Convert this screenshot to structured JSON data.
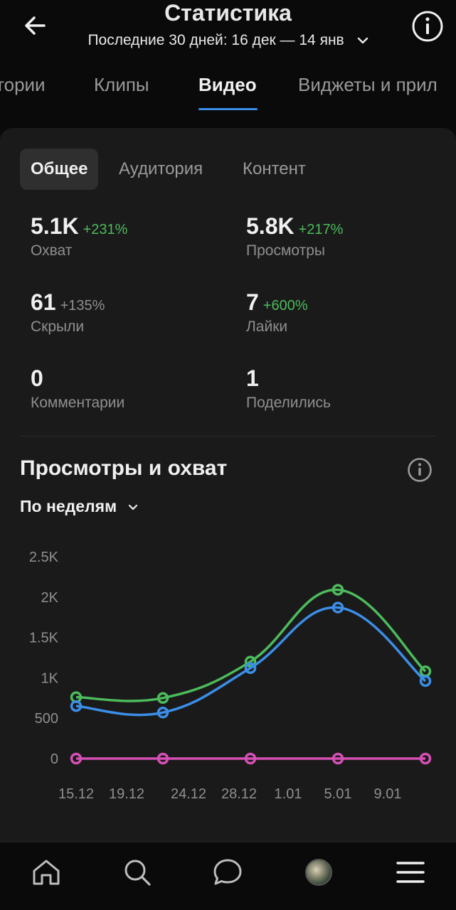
{
  "header": {
    "title": "Статистика",
    "period": "Последние 30 дней: 16 дек — 14 янв"
  },
  "tabs": [
    {
      "label": "тории",
      "active": false
    },
    {
      "label": "Клипы",
      "active": false
    },
    {
      "label": "Видео",
      "active": true
    },
    {
      "label": "Виджеты и прил",
      "active": false
    }
  ],
  "subtabs": [
    {
      "label": "Общее",
      "active": true
    },
    {
      "label": "Аудитория",
      "active": false
    },
    {
      "label": "Контент",
      "active": false
    }
  ],
  "stats": {
    "reach": {
      "value": "5.1K",
      "delta": "+231%",
      "label": "Охват"
    },
    "views": {
      "value": "5.8K",
      "delta": "+217%",
      "label": "Просмотры"
    },
    "hidden": {
      "value": "61",
      "delta": "+135%",
      "label": "Скрыли"
    },
    "likes": {
      "value": "7",
      "delta": "+600%",
      "label": "Лайки"
    },
    "comments": {
      "value": "0",
      "label": "Комментарии"
    },
    "shares": {
      "value": "1",
      "label": "Поделились"
    }
  },
  "chart_section": {
    "title": "Просмотры и охват",
    "granularity": "По неделям"
  },
  "chart_data": {
    "type": "line",
    "x_ticks": [
      "15.12",
      "19.12",
      "24.12",
      "28.12",
      "1.01",
      "5.01",
      "9.01"
    ],
    "y_ticks": [
      "0",
      "500",
      "1K",
      "1.5K",
      "2K",
      "2.5K"
    ],
    "ylim": [
      0,
      2500
    ],
    "series": [
      {
        "color": "#4cbb5c",
        "values": [
          760,
          750,
          1200,
          2090,
          1080
        ]
      },
      {
        "color": "#3b8ee8",
        "values": [
          650,
          570,
          1120,
          1870,
          960
        ]
      },
      {
        "color": "#d64fb4",
        "values": [
          0,
          0,
          0,
          0,
          0
        ]
      }
    ],
    "grid": false
  },
  "colors": {
    "accent": "#3b8ee8",
    "positive": "#4cbb5c",
    "panel": "#1a1a1a",
    "background": "#0a0a0a"
  },
  "icons": {
    "back": "arrow-left-icon",
    "info": "info-icon",
    "nav": [
      "home-icon",
      "search-icon",
      "chat-icon",
      "avatar",
      "menu-icon"
    ]
  }
}
